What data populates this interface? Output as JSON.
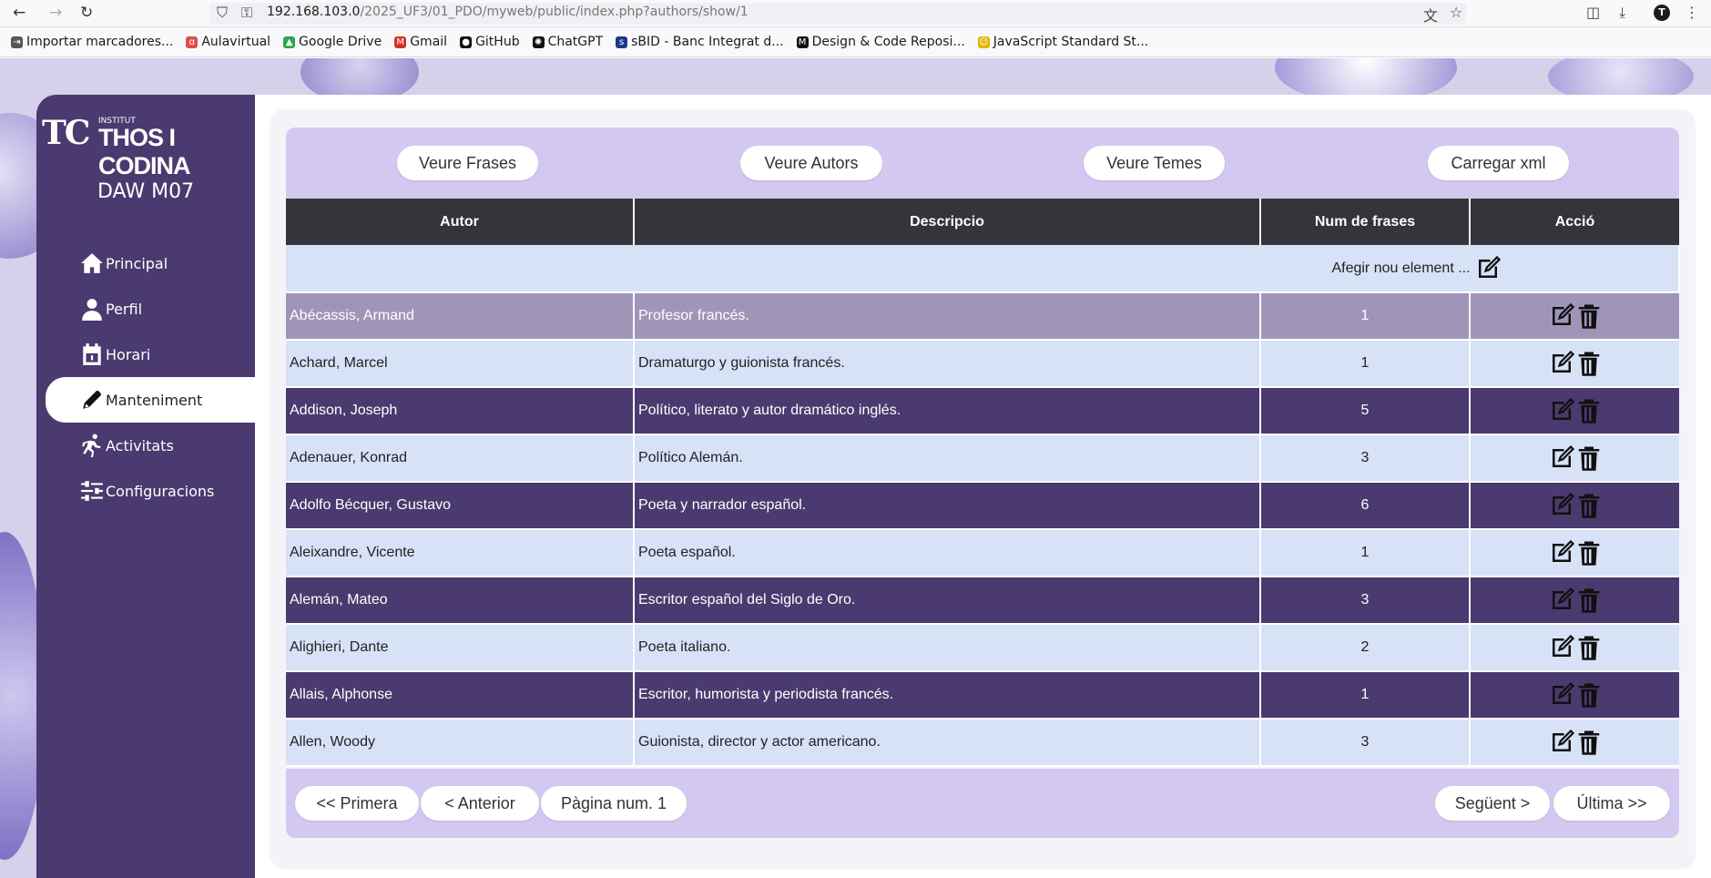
{
  "browser": {
    "url_host": "192.168.103.0",
    "url_path": "/2025_UF3/01_PDO/myweb/public/index.php?authors/show/1",
    "profile_initial": "T",
    "bookmarks": [
      "Importar marcadores...",
      "Aulavirtual",
      "Google Drive",
      "Gmail",
      "GitHub",
      "ChatGPT",
      "sBID - Banc Integrat d...",
      "Design & Code Reposi...",
      "JavaScript Standard St..."
    ]
  },
  "sidebar": {
    "logo_small": "INSTITUT",
    "logo_name": "THOS I CODINA",
    "logo_mark": "TC",
    "course": "DAW M07",
    "items": [
      {
        "label": "Principal",
        "icon": "home-icon"
      },
      {
        "label": "Perfil",
        "icon": "user-icon"
      },
      {
        "label": "Horari",
        "icon": "calendar-icon"
      },
      {
        "label": "Manteniment",
        "icon": "pencil-icon"
      },
      {
        "label": "Activitats",
        "icon": "run-icon"
      },
      {
        "label": "Configuracions",
        "icon": "sliders-icon"
      }
    ]
  },
  "toolbar": {
    "buttons": [
      "Veure Frases",
      "Veure Autors",
      "Veure Temes",
      "Carregar xml"
    ]
  },
  "table": {
    "headers": [
      "Autor",
      "Descripcio",
      "Num de frases",
      "Acció"
    ],
    "add_label": "Afegir nou element ...",
    "rows": [
      {
        "autor": "Abécassis, Armand",
        "desc": "Profesor francés.",
        "num": "1"
      },
      {
        "autor": "Achard, Marcel",
        "desc": "Dramaturgo y guionista francés.",
        "num": "1"
      },
      {
        "autor": "Addison, Joseph",
        "desc": "Político, literato y autor dramático inglés.",
        "num": "5"
      },
      {
        "autor": "Adenauer, Konrad",
        "desc": "Político Alemán.",
        "num": "3"
      },
      {
        "autor": "Adolfo Bécquer, Gustavo",
        "desc": "Poeta y narrador español.",
        "num": "6"
      },
      {
        "autor": "Aleixandre, Vicente",
        "desc": "Poeta español.",
        "num": "1"
      },
      {
        "autor": "Alemán, Mateo",
        "desc": "Escritor español del Siglo de Oro.",
        "num": "3"
      },
      {
        "autor": "Alighieri, Dante",
        "desc": "Poeta italiano.",
        "num": "2"
      },
      {
        "autor": "Allais, Alphonse",
        "desc": "Escritor, humorista y periodista francés.",
        "num": "1"
      },
      {
        "autor": "Allen, Woody",
        "desc": "Guionista, director y actor americano.",
        "num": "3"
      }
    ]
  },
  "pagination": {
    "first": "<< Primera",
    "prev": "< Anterior",
    "page": "Pàgina num. 1",
    "next": "Següent >",
    "last": "Última >>"
  },
  "colors": {
    "sidebar": "#4a3a6f",
    "toolbar": "#d3c9f0",
    "header": "#33353a",
    "row_light": "#d7e2f6",
    "row_dark": "#4a3a6f"
  }
}
